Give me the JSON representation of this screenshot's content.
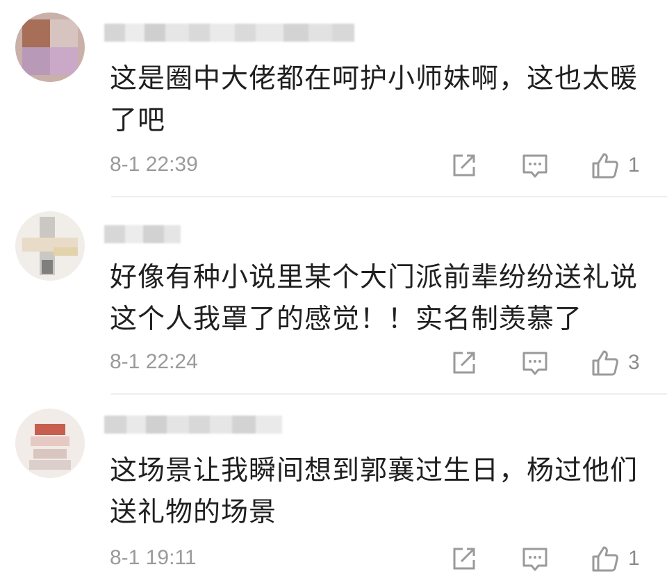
{
  "comments": [
    {
      "text": "这是圈中大佬都在呵护小师妹啊，这也太暖\n了吧",
      "timestamp": "8-1 22:39",
      "likes": "1",
      "avatar_icon": "blurred-avatar",
      "username_blurred": true
    },
    {
      "text": "好像有种小说里某个大门派前辈纷纷送礼说\n这个人我罩了的感觉！！实名制羡慕了",
      "timestamp": "8-1 22:24",
      "likes": "3",
      "avatar_icon": "blurred-avatar",
      "username_blurred": true
    },
    {
      "text": "这场景让我瞬间想到郭襄过生日，杨过他们\n送礼物的场景",
      "timestamp": "8-1 19:11",
      "likes": "1",
      "avatar_icon": "blurred-avatar",
      "username_blurred": true
    }
  ],
  "actions": {
    "share_icon": "share-icon",
    "reply_icon": "comment-icon",
    "like_icon": "thumbs-up-icon"
  },
  "colors": {
    "text": "#1f1f1f",
    "meta": "#9a9a9a",
    "icon": "#9a9a9a",
    "divider": "#eeeeee"
  }
}
